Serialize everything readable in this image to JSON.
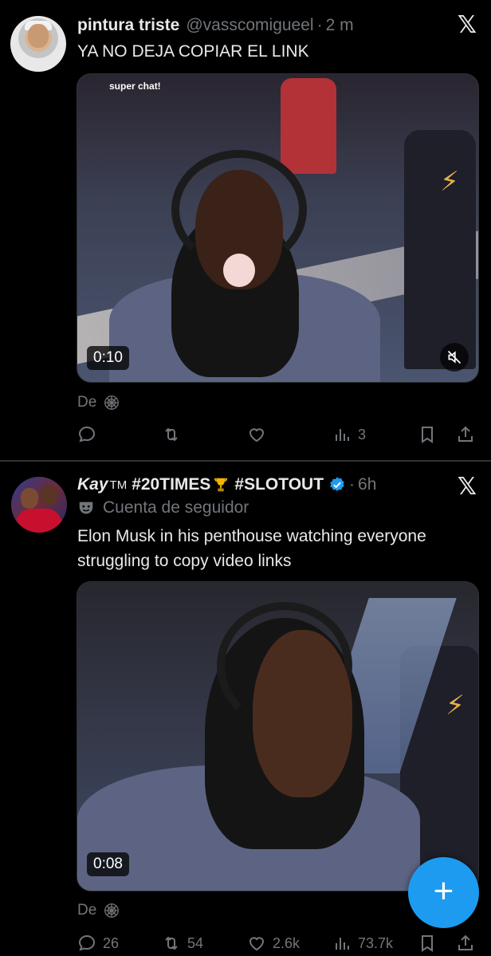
{
  "tweets": [
    {
      "author_name": "pintura triste",
      "handle": "@vasscomigueel",
      "separator": "·",
      "time": "2 m",
      "text": "YA NO DEJA COPIAR EL LINK",
      "media_caption": "super chat!",
      "video_duration": "0:10",
      "via_label": "De",
      "counts": {
        "replies": "",
        "reposts": "",
        "likes": "",
        "views": "3"
      }
    },
    {
      "author_name": "Kay",
      "author_tm": "TM",
      "author_tag1": "#20TIMES",
      "author_tag2": "#SLOTOUT",
      "separator": "·",
      "time": "6h",
      "community": "Cuenta de seguidor",
      "text": "Elon Musk in his penthouse watching everyone struggling to copy video links",
      "video_duration": "0:08",
      "via_label": "De",
      "counts": {
        "replies": "26",
        "reposts": "54",
        "likes": "2.6k",
        "views": "73.7k"
      }
    }
  ],
  "colors": {
    "background": "#000000",
    "text": "#e7e9ea",
    "muted": "#71767b",
    "accent": "#1d9bf0"
  },
  "icons": [
    "x-logo-icon",
    "reply-icon",
    "repost-icon",
    "like-icon",
    "views-icon",
    "bookmark-icon",
    "share-icon",
    "mute-icon",
    "globe-web-icon",
    "community-mask-icon",
    "verified-badge-icon",
    "trophy-icon",
    "compose-plus-icon"
  ],
  "fab": {
    "label": "+"
  }
}
